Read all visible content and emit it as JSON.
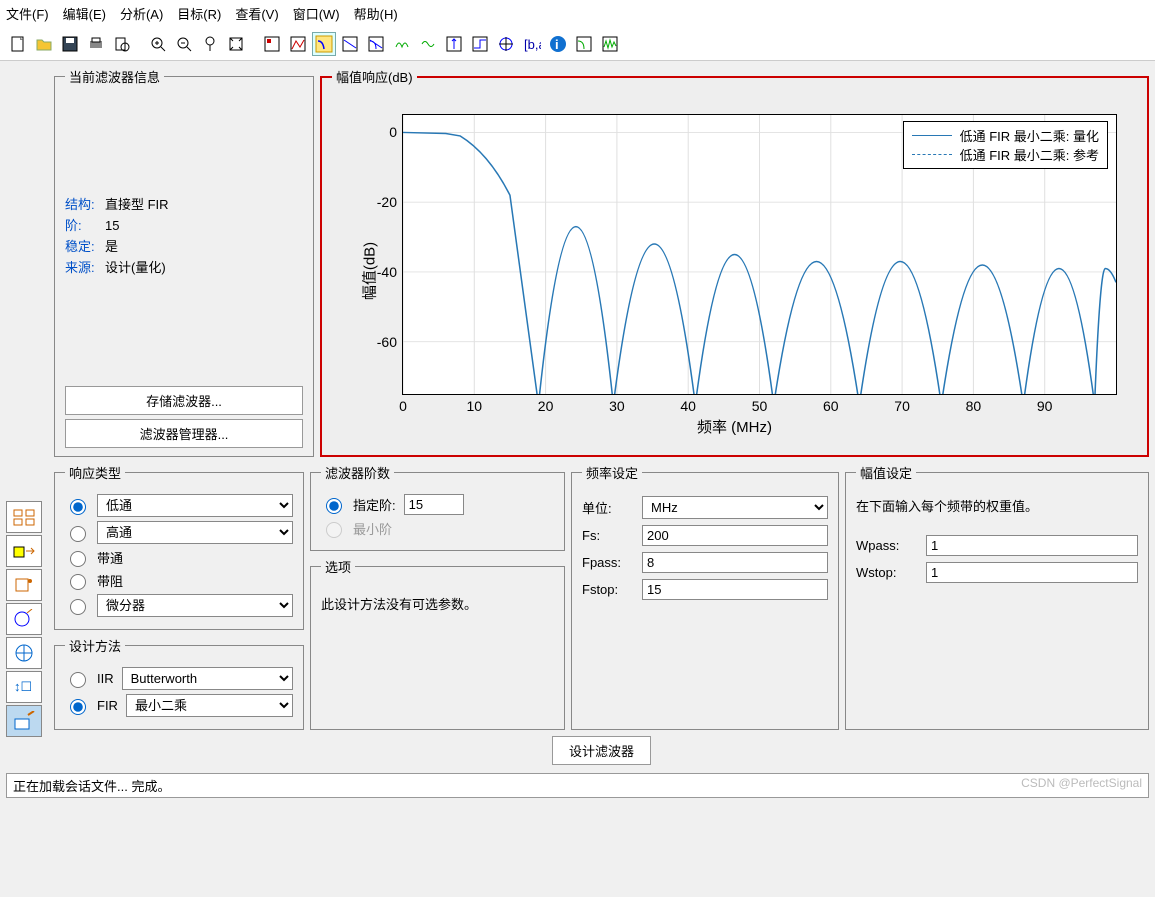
{
  "menubar": [
    "文件(F)",
    "编辑(E)",
    "分析(A)",
    "目标(R)",
    "查看(V)",
    "窗口(W)",
    "帮助(H)"
  ],
  "info": {
    "title": "当前滤波器信息",
    "rows": [
      {
        "label": "结构:",
        "value": "直接型 FIR"
      },
      {
        "label": "阶:",
        "value": "15"
      },
      {
        "label": "稳定:",
        "value": "是"
      },
      {
        "label": "来源:",
        "value": "设计(量化)"
      }
    ],
    "btn_store": "存储滤波器...",
    "btn_mgr": "滤波器管理器..."
  },
  "plot": {
    "title": "幅值响应(dB)",
    "ylabel": "幅值(dB)",
    "xlabel": "频率 (MHz)",
    "legend": [
      "低通 FIR 最小二乘: 量化",
      "低通 FIR 最小二乘: 参考"
    ]
  },
  "chart_data": {
    "type": "line",
    "xlabel": "频率 (MHz)",
    "ylabel": "幅值(dB)",
    "xlim": [
      0,
      100
    ],
    "ylim": [
      -75,
      5
    ],
    "xticks": [
      0,
      10,
      20,
      30,
      40,
      50,
      60,
      70,
      80,
      90
    ],
    "yticks": [
      0,
      -20,
      -40,
      -60
    ],
    "series": [
      {
        "name": "低通 FIR 最小二乘: 量化",
        "nulls_at": [
          19,
          29.5,
          41,
          52,
          64,
          75.5,
          87,
          97
        ],
        "lobe_peaks_db": [
          -27,
          -32,
          -35,
          -37,
          -37,
          -38,
          -39,
          -39
        ]
      }
    ],
    "note": "Passband ≈0 dB from 0–8 MHz, rolloff to first null near 19 MHz, then sidelobes with peaks around −27…−39 dB and deep nulls (< −70 dB)."
  },
  "resp": {
    "title": "响应类型",
    "opts": [
      "低通",
      "高通",
      "带通",
      "带阻",
      "微分器"
    ],
    "method_title": "设计方法",
    "iir": "IIR",
    "iir_sel": "Butterworth",
    "fir": "FIR",
    "fir_sel": "最小二乘"
  },
  "order": {
    "title": "滤波器阶数",
    "spec": "指定阶:",
    "spec_val": "15",
    "min": "最小阶"
  },
  "options": {
    "title": "选项",
    "msg": "此设计方法没有可选参数。"
  },
  "freq": {
    "title": "频率设定",
    "unit_lbl": "单位:",
    "unit": "MHz",
    "fs_lbl": "Fs:",
    "fs": "200",
    "fpass_lbl": "Fpass:",
    "fpass": "8",
    "fstop_lbl": "Fstop:",
    "fstop": "15"
  },
  "mag": {
    "title": "幅值设定",
    "msg": "在下面输入每个频带的权重值。",
    "wpass_lbl": "Wpass:",
    "wpass": "1",
    "wstop_lbl": "Wstop:",
    "wstop": "1"
  },
  "design_btn": "设计滤波器",
  "status": "正在加载会话文件... 完成。",
  "watermark": "CSDN @PerfectSignal"
}
